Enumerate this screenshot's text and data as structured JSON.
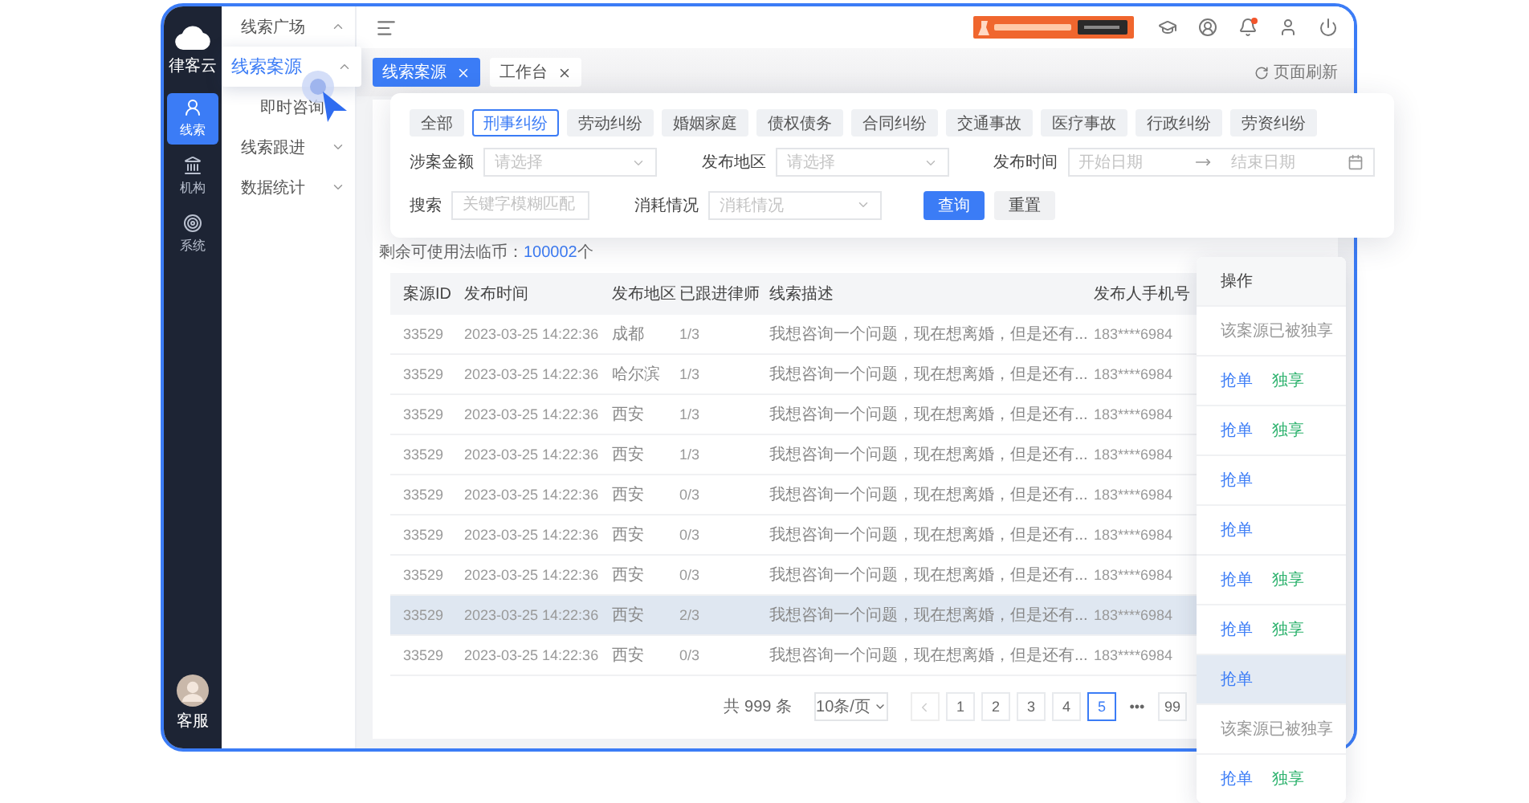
{
  "brand": {
    "name": "律客云"
  },
  "nav": [
    {
      "label": "线索",
      "selected": true
    },
    {
      "label": "机构",
      "selected": false
    },
    {
      "label": "系统",
      "selected": false
    }
  ],
  "support": {
    "label": "客服"
  },
  "submenu": [
    {
      "label": "线索广场",
      "kind": "group",
      "expanded": true,
      "raised": false
    },
    {
      "label": "线索案源",
      "kind": "group",
      "expanded": true,
      "raised": true
    },
    {
      "label": "即时咨询",
      "kind": "child",
      "raised": false
    },
    {
      "label": "线索跟进",
      "kind": "group",
      "expanded": false,
      "raised": false
    },
    {
      "label": "数据统计",
      "kind": "group",
      "expanded": false,
      "raised": false
    }
  ],
  "tabs": [
    {
      "label": "线索案源",
      "selected": true
    },
    {
      "label": "工作台",
      "selected": false
    }
  ],
  "refresh": {
    "label": "页面刷新"
  },
  "filters": {
    "categories": [
      {
        "label": "全部",
        "selected": false
      },
      {
        "label": "刑事纠纷",
        "selected": true
      },
      {
        "label": "劳动纠纷",
        "selected": false
      },
      {
        "label": "婚姻家庭",
        "selected": false
      },
      {
        "label": "债权债务",
        "selected": false
      },
      {
        "label": "合同纠纷",
        "selected": false
      },
      {
        "label": "交通事故",
        "selected": false
      },
      {
        "label": "医疗事故",
        "selected": false
      },
      {
        "label": "行政纠纷",
        "selected": false
      },
      {
        "label": "劳资纠纷",
        "selected": false
      }
    ],
    "row_1": [
      {
        "label": "涉案金额",
        "kind": "select",
        "placeholder": "请选择"
      },
      {
        "label": "发布地区",
        "kind": "select",
        "placeholder": "请选择"
      },
      {
        "label": "发布时间",
        "kind": "daterange",
        "start": {
          "placeholder": "开始日期"
        },
        "end": {
          "placeholder": "结束日期"
        }
      }
    ],
    "row_2": [
      {
        "label": "搜索",
        "kind": "text",
        "placeholder": "关键字模糊匹配"
      },
      {
        "label": "消耗情况",
        "kind": "select",
        "placeholder": "消耗情况"
      }
    ],
    "buttons": [
      {
        "label": "查询",
        "kind": "primary"
      },
      {
        "label": "重置",
        "kind": "default"
      }
    ]
  },
  "balance": {
    "label": "剩余可使用法临币：",
    "count": "100002",
    "unit": "个"
  },
  "table": {
    "columns": [
      "案源ID",
      "发布时间",
      "发布地区",
      "已跟进律师",
      "线索描述",
      "发布人手机号"
    ],
    "rows": [
      {
        "cells": [
          "33529",
          "2023-03-25 14:22:36",
          "成都",
          "1/3",
          "我想咨询一个问题，现在想离婚，但是还有...",
          "183****6984"
        ],
        "selected": false
      },
      {
        "cells": [
          "33529",
          "2023-03-25 14:22:36",
          "哈尔滨",
          "1/3",
          "我想咨询一个问题，现在想离婚，但是还有...",
          "183****6984"
        ],
        "selected": false
      },
      {
        "cells": [
          "33529",
          "2023-03-25 14:22:36",
          "西安",
          "1/3",
          "我想咨询一个问题，现在想离婚，但是还有...",
          "183****6984"
        ],
        "selected": false
      },
      {
        "cells": [
          "33529",
          "2023-03-25 14:22:36",
          "西安",
          "1/3",
          "我想咨询一个问题，现在想离婚，但是还有...",
          "183****6984"
        ],
        "selected": false
      },
      {
        "cells": [
          "33529",
          "2023-03-25 14:22:36",
          "西安",
          "0/3",
          "我想咨询一个问题，现在想离婚，但是还有...",
          "183****6984"
        ],
        "selected": false
      },
      {
        "cells": [
          "33529",
          "2023-03-25 14:22:36",
          "西安",
          "0/3",
          "我想咨询一个问题，现在想离婚，但是还有...",
          "183****6984"
        ],
        "selected": false
      },
      {
        "cells": [
          "33529",
          "2023-03-25 14:22:36",
          "西安",
          "0/3",
          "我想咨询一个问题，现在想离婚，但是还有...",
          "183****6984"
        ],
        "selected": false
      },
      {
        "cells": [
          "33529",
          "2023-03-25 14:22:36",
          "西安",
          "2/3",
          "我想咨询一个问题，现在想离婚，但是还有...",
          "183****6984"
        ],
        "selected": true
      },
      {
        "cells": [
          "33529",
          "2023-03-25 14:22:36",
          "西安",
          "0/3",
          "我想咨询一个问题，现在想离婚，但是还有...",
          "183****6984"
        ],
        "selected": false
      }
    ]
  },
  "operations": {
    "header": "操作",
    "rows": [
      {
        "note": "该案源已被独享",
        "selected": false
      },
      {
        "links": [
          {
            "label": "抢单",
            "kind": "grab"
          },
          {
            "label": "独享",
            "kind": "exclusive"
          }
        ],
        "selected": false
      },
      {
        "links": [
          {
            "label": "抢单",
            "kind": "grab"
          },
          {
            "label": "独享",
            "kind": "exclusive"
          }
        ],
        "selected": false
      },
      {
        "links": [
          {
            "label": "抢单",
            "kind": "grab"
          }
        ],
        "selected": false
      },
      {
        "links": [
          {
            "label": "抢单",
            "kind": "grab"
          }
        ],
        "selected": false
      },
      {
        "links": [
          {
            "label": "抢单",
            "kind": "grab"
          },
          {
            "label": "独享",
            "kind": "exclusive"
          }
        ],
        "selected": false
      },
      {
        "links": [
          {
            "label": "抢单",
            "kind": "grab"
          },
          {
            "label": "独享",
            "kind": "exclusive"
          }
        ],
        "selected": false
      },
      {
        "links": [
          {
            "label": "抢单",
            "kind": "grab"
          }
        ],
        "selected": true
      },
      {
        "note": "该案源已被独享",
        "selected": false
      },
      {
        "links": [
          {
            "label": "抢单",
            "kind": "grab"
          },
          {
            "label": "独享",
            "kind": "exclusive"
          }
        ],
        "selected": false
      }
    ]
  },
  "pagination": {
    "total": "共 999 条",
    "page_size": "10条/页",
    "pages": [
      {
        "label": "1",
        "kind": "page",
        "selected": false
      },
      {
        "label": "2",
        "kind": "page",
        "selected": false
      },
      {
        "label": "3",
        "kind": "page",
        "selected": false
      },
      {
        "label": "4",
        "kind": "page",
        "selected": false
      },
      {
        "label": "5",
        "kind": "page",
        "selected": true
      },
      {
        "label": "•••",
        "kind": "ellipsis",
        "selected": false
      },
      {
        "label": "99",
        "kind": "page",
        "selected": false
      }
    ]
  }
}
